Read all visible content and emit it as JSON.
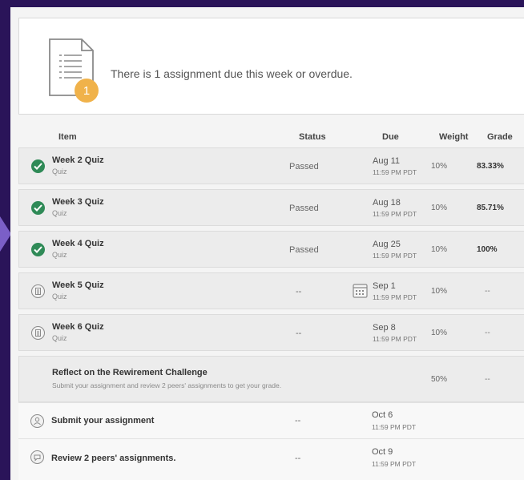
{
  "banner": {
    "badge_count": "1",
    "message": "There is 1 assignment due this week or overdue."
  },
  "table": {
    "headers": {
      "item": "Item",
      "status": "Status",
      "due": "Due",
      "weight": "Weight",
      "grade": "Grade"
    },
    "rows": [
      {
        "title": "Week 2 Quiz",
        "type": "Quiz",
        "status": "Passed",
        "due_date": "Aug 11",
        "due_time": "11:59 PM PDT",
        "weight": "10%",
        "grade": "83.33%",
        "icon": "check-circle-icon"
      },
      {
        "title": "Week 3 Quiz",
        "type": "Quiz",
        "status": "Passed",
        "due_date": "Aug 18",
        "due_time": "11:59 PM PDT",
        "weight": "10%",
        "grade": "85.71%",
        "icon": "check-circle-icon"
      },
      {
        "title": "Week 4 Quiz",
        "type": "Quiz",
        "status": "Passed",
        "due_date": "Aug 25",
        "due_time": "11:59 PM PDT",
        "weight": "10%",
        "grade": "100%",
        "icon": "check-circle-icon"
      },
      {
        "title": "Week 5 Quiz",
        "type": "Quiz",
        "status": "--",
        "due_date": "Sep 1",
        "due_time": "11:59 PM PDT",
        "weight": "10%",
        "grade": "--",
        "icon": "quiz-icon"
      },
      {
        "title": "Week 6 Quiz",
        "type": "Quiz",
        "status": "--",
        "due_date": "Sep 8",
        "due_time": "11:59 PM PDT",
        "weight": "10%",
        "grade": "--",
        "icon": "quiz-icon"
      }
    ],
    "peer": {
      "title": "Reflect on the Rewirement Challenge",
      "description": "Submit your assignment and review 2 peers' assignments to get your grade.",
      "weight": "50%",
      "grade": "--",
      "steps": [
        {
          "title": "Submit your assignment",
          "status": "--",
          "due_date": "Oct 6",
          "due_time": "11:59 PM PDT",
          "icon": "submit-person-icon"
        },
        {
          "title": "Review 2 peers' assignments.",
          "status": "--",
          "due_date": "Oct 9",
          "due_time": "11:59 PM PDT",
          "icon": "review-chat-icon"
        }
      ]
    }
  },
  "colors": {
    "passed_green": "#2f8a57",
    "badge_orange": "#f0b24a",
    "frame_purple": "#2a1459"
  }
}
